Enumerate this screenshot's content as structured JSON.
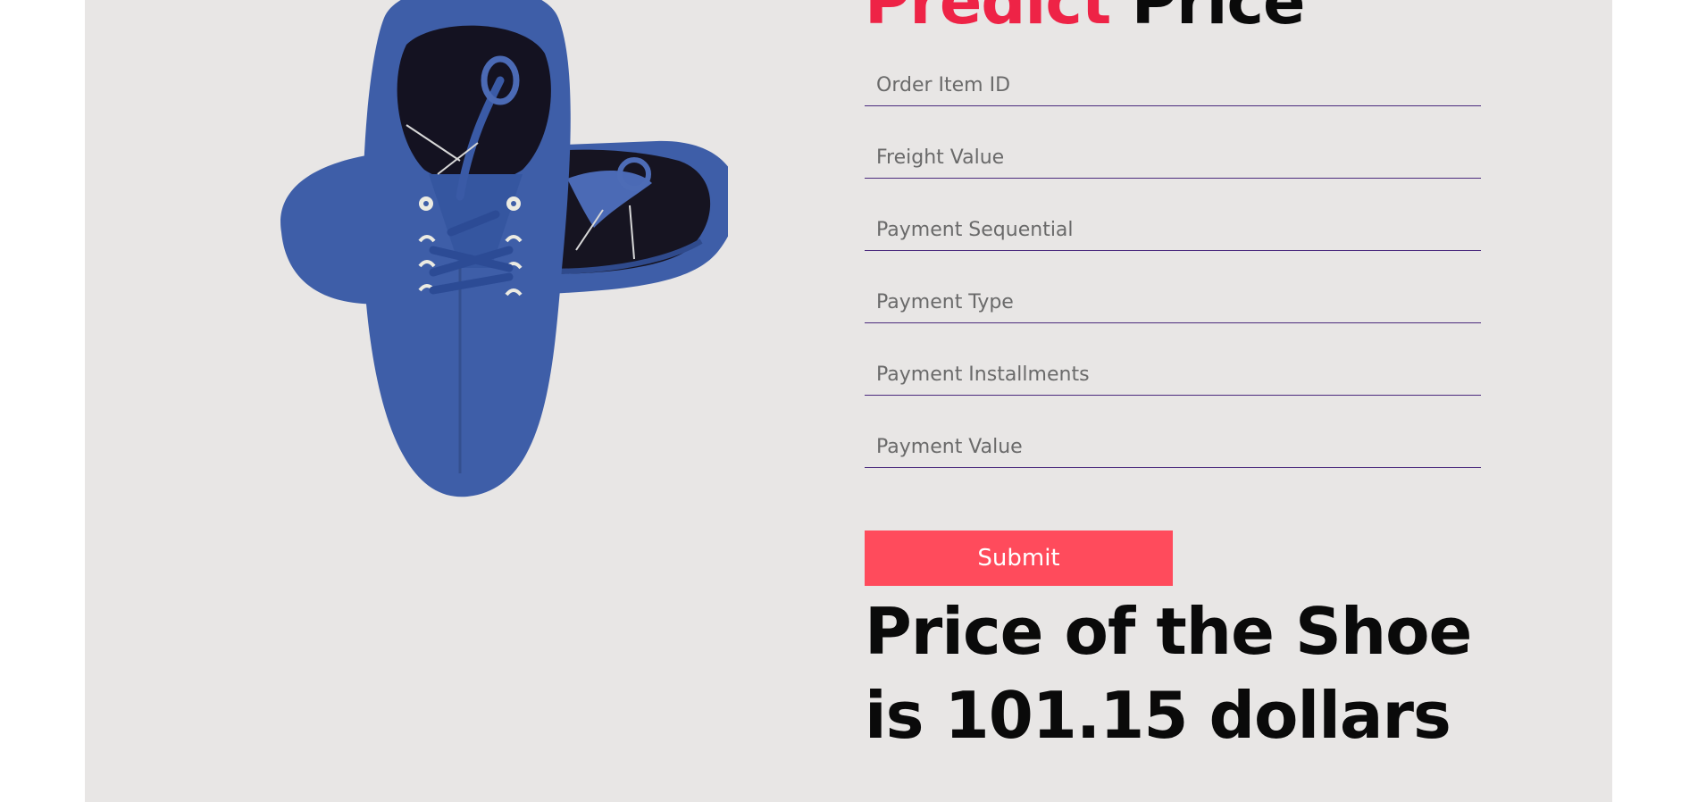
{
  "header": {
    "title_accent": "Predict",
    "title_rest": "Price"
  },
  "colors": {
    "accent": "#ee2346",
    "button": "#ff4b5c",
    "panel_background": "#e8e6e5",
    "field_underline": "#4b2a7d"
  },
  "image": {
    "icon": "blue-shoes-illustration"
  },
  "form": {
    "fields": [
      {
        "placeholder": "Order Item ID",
        "value": ""
      },
      {
        "placeholder": "Freight Value",
        "value": ""
      },
      {
        "placeholder": "Payment Sequential",
        "value": ""
      },
      {
        "placeholder": "Payment Type",
        "value": ""
      },
      {
        "placeholder": "Payment Installments",
        "value": ""
      },
      {
        "placeholder": "Payment Value",
        "value": ""
      }
    ],
    "submit_label": "Submit"
  },
  "result": {
    "text": "Price of the Shoe is 101.15 dollars"
  }
}
